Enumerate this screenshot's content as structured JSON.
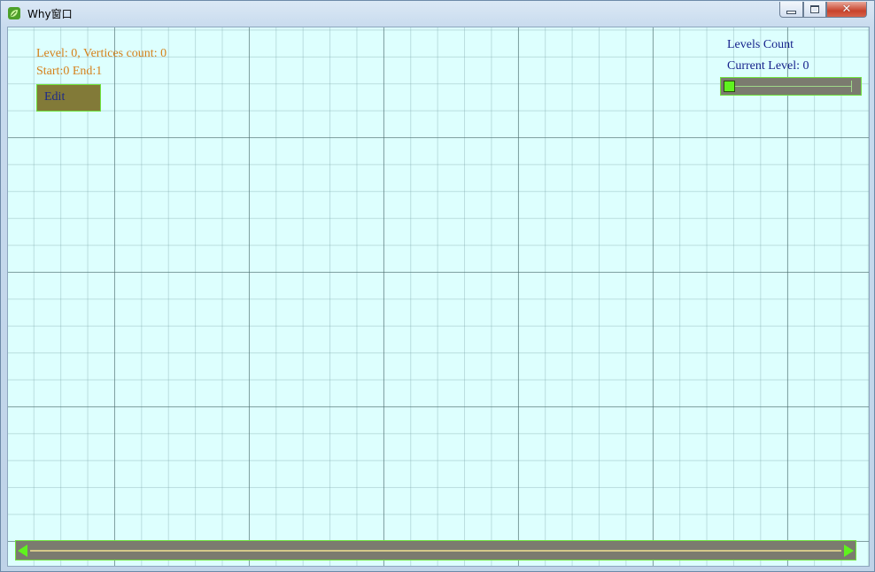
{
  "window": {
    "title": "Why窗口",
    "icon": "leaf-icon"
  },
  "overlay": {
    "info_line1": "Level: 0, Vertices count: 0",
    "info_line2": "Start:0 End:1",
    "edit_label": "Edit"
  },
  "levels_panel": {
    "levels_count_label": "Levels Count",
    "current_level_label": "Current Level: 0",
    "slider_value": 0
  },
  "colors": {
    "canvas_bg": "#ddfffe",
    "info_text": "#d5801a",
    "panel_text": "#16228c",
    "control_fill": "#7b7b6f",
    "control_border": "#6fe23c",
    "thumb": "#5ff21e"
  }
}
